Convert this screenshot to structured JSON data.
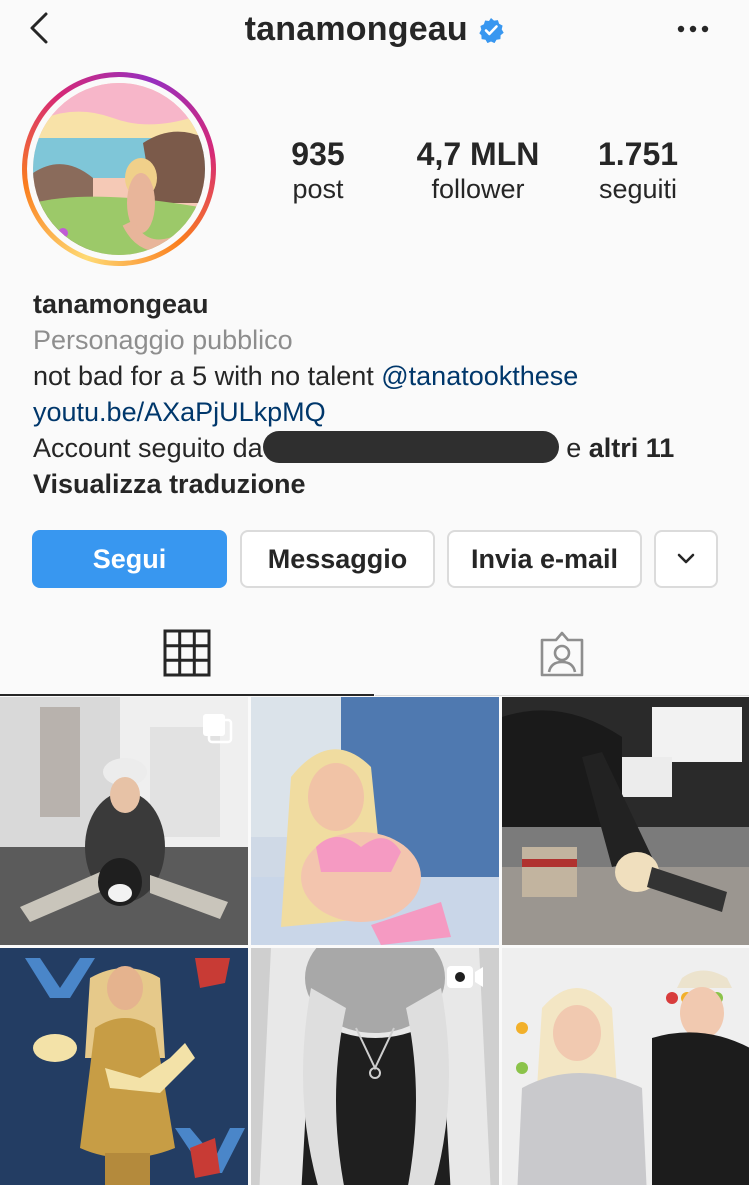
{
  "header": {
    "username": "tanamongeau",
    "verified": true,
    "icons": {
      "back": "chevron-left-icon",
      "verified": "verified-badge-icon",
      "more": "more-dots-icon"
    }
  },
  "profile": {
    "stats": [
      {
        "value": "935",
        "label": "post"
      },
      {
        "value": "4,7 MLN",
        "label": "follower"
      },
      {
        "value": "1.751",
        "label": "seguiti"
      }
    ],
    "bio": {
      "name": "tanamongeau",
      "category": "Personaggio pubblico",
      "text": "not bad for a 5 with no talent",
      "mention": "@tanatookthese",
      "link": "youtu.be/AXaPjULkpMQ",
      "followed_by_prefix": "Account seguito da",
      "followed_by_suffix": "e",
      "followed_by_others": "altri 11",
      "translate": "Visualizza traduzione"
    }
  },
  "actions": {
    "follow": "Segui",
    "message": "Messaggio",
    "email": "Invia e-mail",
    "more_icon": "chevron-down-icon"
  },
  "tabs": [
    {
      "name": "grid",
      "icon": "grid-icon",
      "active": true
    },
    {
      "name": "tagged",
      "icon": "tagged-person-icon",
      "active": false
    }
  ],
  "posts": [
    {
      "badge": "carousel-icon"
    },
    {
      "badge": null
    },
    {
      "badge": null
    },
    {
      "badge": null
    },
    {
      "badge": "video-icon"
    },
    {
      "badge": null
    }
  ],
  "colors": {
    "accent": "#3897f0",
    "verified": "#3897f0",
    "link": "#00376b",
    "secondary_text": "#8e8e8e",
    "border": "#dbdbdb",
    "background": "#fafafa"
  }
}
